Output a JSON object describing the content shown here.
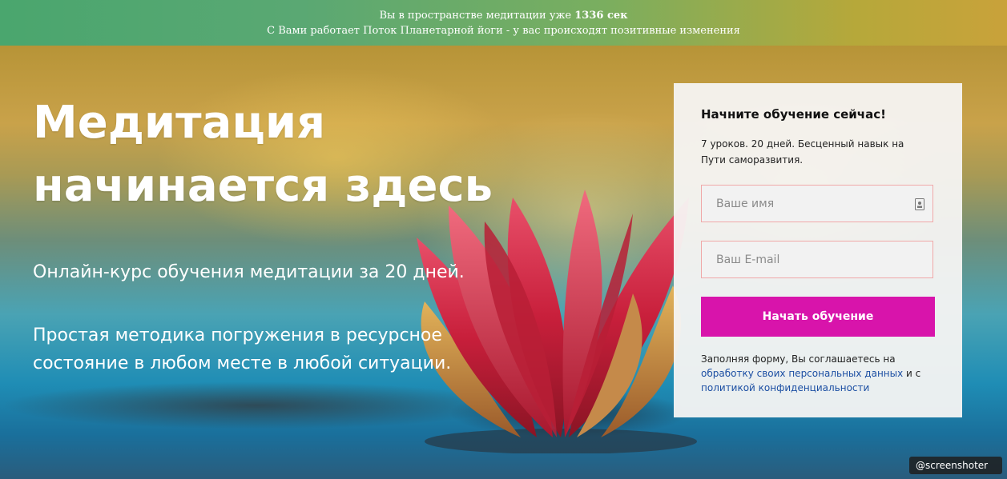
{
  "banner": {
    "line1_prefix": "Вы в пространстве медитации уже ",
    "seconds": "1336 сек",
    "line2": "С Вами работает Поток Планетарной йоги - у вас происходят позитивные изменения"
  },
  "hero": {
    "headline_line1": "Медитация",
    "headline_line2": "начинается здесь",
    "subtitle": "Онлайн-курс обучения медитации за 20 дней.",
    "description": "Простая методика погружения в ресурсное состояние в любом месте в любой ситуации."
  },
  "form": {
    "title": "Начните обучение сейчас!",
    "description": "7 уроков. 20 дней. Бесценный навык на Пути саморазвития.",
    "name_placeholder": "Ваше имя",
    "email_placeholder": "Ваш E-mail",
    "submit_label": "Начать обучение",
    "consent_prefix": "Заполняя форму, Вы соглашаетесь на ",
    "consent_link1": "обработку своих персональных данных",
    "consent_middle": " и с ",
    "consent_link2": "политикой конфиденциальности"
  },
  "colors": {
    "accent": "#d814ab",
    "link": "#1c4fa3"
  },
  "icons": {
    "name_field_icon": "contact-card-icon",
    "watermark_icon": "at-icon"
  },
  "watermark": {
    "label": "@screenshoter"
  }
}
